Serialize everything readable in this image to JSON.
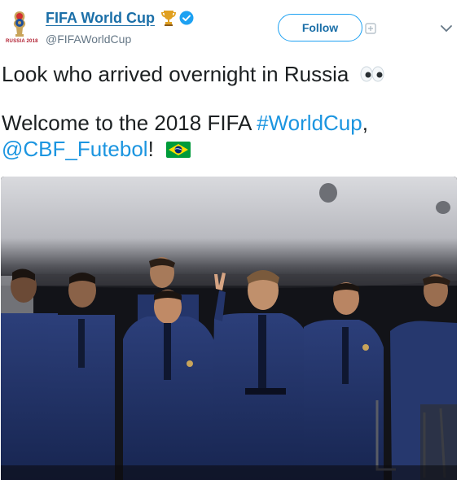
{
  "account": {
    "display_name": "FIFA World Cup",
    "handle": "@FIFAWorldCup",
    "logo_caption": "RUSSIA 2018",
    "verified": true
  },
  "actions": {
    "follow_label": "Follow"
  },
  "tweet": {
    "line1": "Look who arrived overnight in Russia",
    "line2_prefix": "Welcome to the 2018 FIFA ",
    "hashtag": "#WorldCup",
    "line2_suffix": ",",
    "mention": "@CBF_Futebol",
    "line3_suffix": "!",
    "emojis": [
      "eyes-emoji",
      "brazil-flag-emoji"
    ]
  },
  "media": {
    "type": "photo",
    "subject": "team-in-blue-suits-at-night"
  },
  "colors": {
    "link": "#1b95e0",
    "name": "#1b6fa8",
    "handle": "#657786",
    "follow_border": "#1da1f2",
    "verified": "#1da1f2"
  }
}
